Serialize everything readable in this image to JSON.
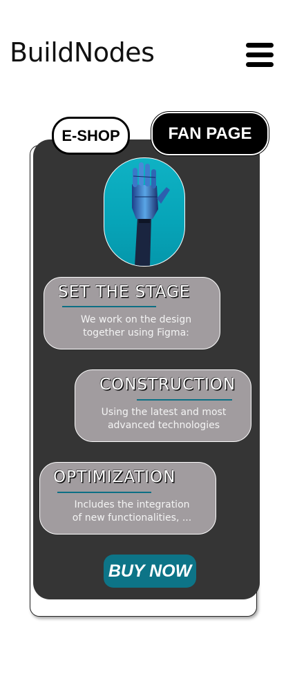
{
  "header": {
    "brand": "BuildNodes",
    "menu_icon": "hamburger-menu-icon"
  },
  "tabs": {
    "eshop": "E-SHOP",
    "fanpage": "FAN PAGE"
  },
  "hero": {
    "image": "robot-hand-image"
  },
  "steps": [
    {
      "title": "SET THE STAGE",
      "desc_line1": "We work on the design",
      "desc_line2": "together using Figma:"
    },
    {
      "title": "CONSTRUCTION",
      "desc_line1": "Using the latest and most",
      "desc_line2": "advanced technologies"
    },
    {
      "title": "OPTIMIZATION",
      "desc_line1": "Includes the integration",
      "desc_line2": "of new functionalities, ..."
    }
  ],
  "cta": {
    "label": "BUY NOW"
  },
  "colors": {
    "card": "#353535",
    "step_box": "#a19c9f",
    "accent": "#0d7487",
    "hero_bg": "#06a4b8"
  }
}
